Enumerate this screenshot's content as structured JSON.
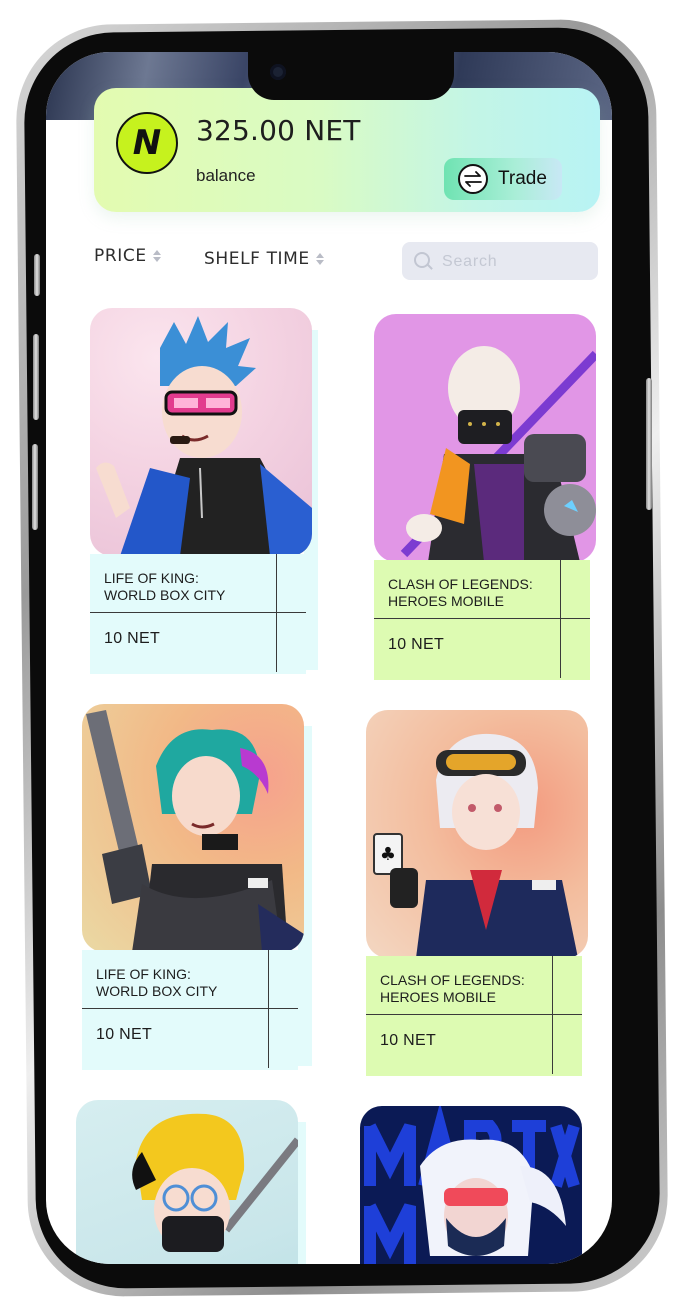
{
  "balance": {
    "amount": "325.00 NET",
    "label": "balance",
    "logo_letter": "N",
    "trade_label": "Trade"
  },
  "filters": {
    "price_label": "PRICE",
    "shelf_time_label": "SHELF TIME",
    "search_placeholder": "Search"
  },
  "cards": [
    {
      "title": "LIFE OF KING: WORLD BOX CITY",
      "price": "10 NET",
      "theme": "cyan",
      "art": "blue-haired man with pink shutter glasses and pipe"
    },
    {
      "title": "CLASH OF LEGENDS: HEROES MOBILE",
      "price": "10 NET",
      "theme": "lime",
      "art": "bald cyborg with mask and staff"
    },
    {
      "title": "LIFE OF KING: WORLD BOX CITY",
      "price": "10 NET",
      "theme": "cyan",
      "art": "teal-haired girl with rifle"
    },
    {
      "title": "CLASH OF LEGENDS: HEROES MOBILE",
      "price": "10 NET",
      "theme": "lime",
      "art": "white-haired girl with goggles and card"
    },
    {
      "title": "",
      "price": "",
      "theme": "cyan",
      "art": "blonde character with mask and glasses"
    },
    {
      "title": "",
      "price": "",
      "theme": "lime",
      "art": "white-haired masked girl on blue poster"
    }
  ],
  "colors": {
    "balance_gradient_start": "#e3fbb0",
    "balance_gradient_end": "#b8f3f4",
    "logo_bg": "#c6f21e",
    "trade_btn": "#6fe3b2",
    "card_info_cyan": "#e3fbfb",
    "card_info_lime": "#ddfbb2",
    "search_bg": "#e7e9f1"
  },
  "icons": [
    "exchange-arrows-icon",
    "search-icon",
    "sort-arrows-icon",
    "front-camera-icon"
  ]
}
